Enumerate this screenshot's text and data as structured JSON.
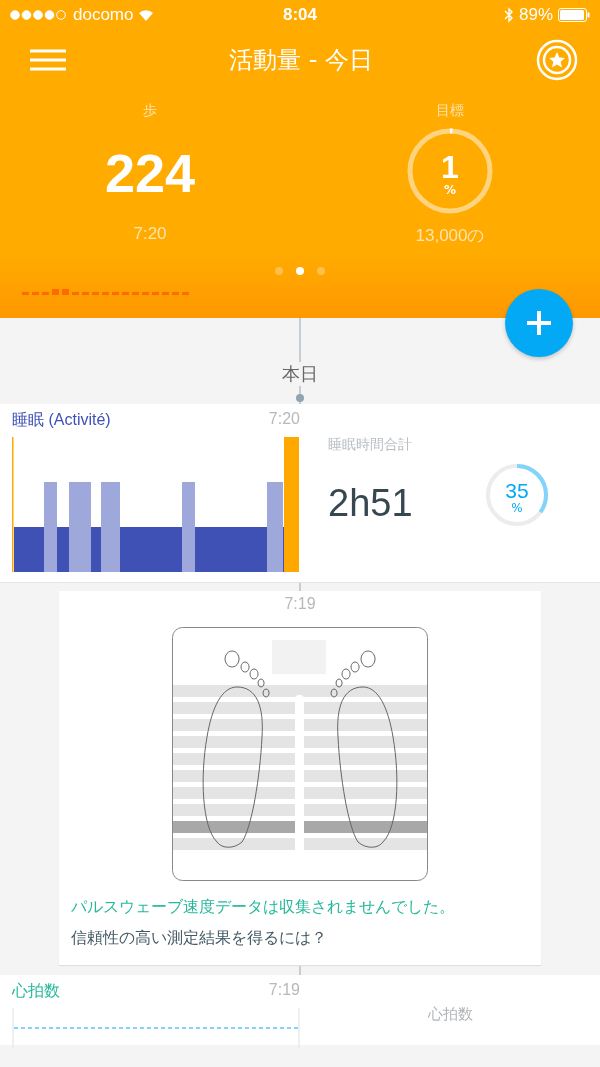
{
  "status_bar": {
    "carrier": "docomo",
    "time": "8:04",
    "battery": "89%"
  },
  "header": {
    "title": "活動量 - 今日"
  },
  "summary": {
    "steps_label": "歩",
    "steps": "224",
    "steps_time": "7:20",
    "goal_label": "目標",
    "goal_value": "1",
    "goal_unit": "%",
    "goal_total": "13,000の"
  },
  "pager": [
    {
      "selected": false
    },
    {
      "selected": true
    },
    {
      "selected": false
    }
  ],
  "timeline": {
    "day_label": "本日"
  },
  "sleep_card": {
    "title": "睡眠 (Activité)",
    "time": "7:20",
    "total_label": "睡眠時間合計",
    "total": "2h51",
    "percent": "35",
    "percent_unit": "%"
  },
  "scale_card": {
    "time": "7:19",
    "warning": "パルスウェーブ速度データは収集されませんでした。",
    "link": "信頼性の高い測定結果を得るには？"
  },
  "heart_card": {
    "title": "心拍数",
    "time": "7:19",
    "label": "心拍数"
  }
}
